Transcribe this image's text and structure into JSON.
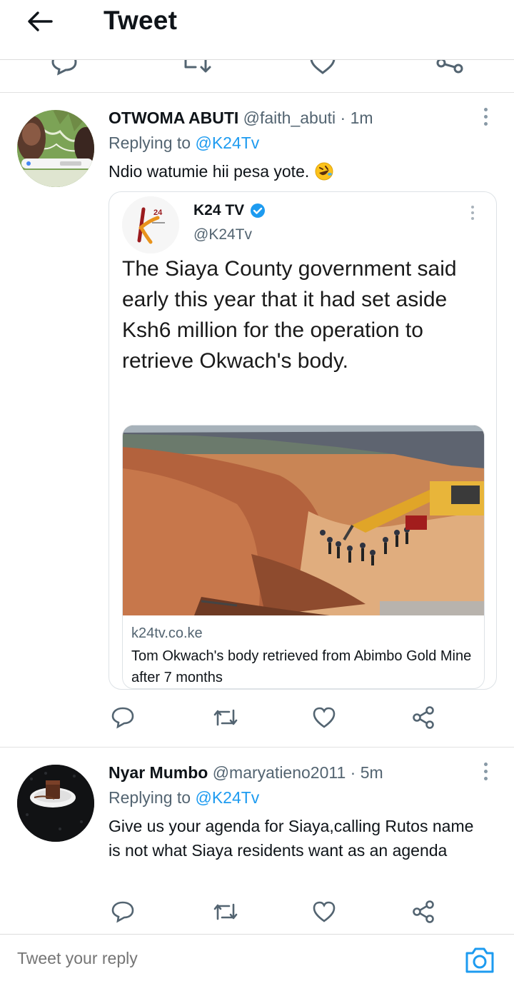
{
  "header": {
    "title": "Tweet",
    "back_icon": "arrow-left-icon"
  },
  "clipped_actions": [
    "reply-icon",
    "retweet-icon",
    "like-icon",
    "share-icon"
  ],
  "tweets": [
    {
      "name": "OTWOMA ABUTI",
      "handle": "@faith_abuti",
      "time": "· 1m",
      "replying_label": "Replying to",
      "replying_to": "@K24Tv",
      "text": "Ndio watumie hii pesa yote.",
      "emoji": "rolling-on-floor-laughing-emoji",
      "quote": {
        "name": "K24 TV",
        "verified": true,
        "handle": "@K24Tv",
        "text": "The Siaya County government said early this year that it had set aside Ksh6 million for the operation to retrieve Okwach's body.",
        "card": {
          "domain": "k24tv.co.ke",
          "title": "Tom Okwach's body retrieved from Abimbo Gold Mine after 7 months"
        }
      }
    },
    {
      "name": "Nyar Mumbo",
      "handle": "@maryatieno2011",
      "time": "· 5m",
      "replying_label": "Replying to",
      "replying_to": "@K24Tv",
      "text": "Give us your agenda for Siaya,calling Rutos name is not what Siaya residents want as an agenda"
    }
  ],
  "composer": {
    "placeholder": "Tweet your reply",
    "camera_icon": "camera-icon"
  },
  "colors": {
    "accent": "#1d9bf0",
    "text": "#0f1419",
    "secondary": "#536471",
    "border": "#e2e2e2"
  }
}
